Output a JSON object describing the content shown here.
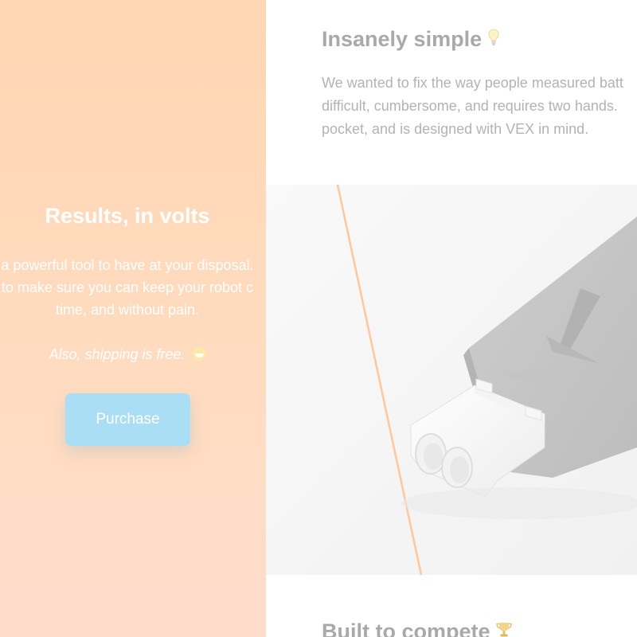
{
  "left": {
    "title": "Results, in volts",
    "body_lines": [
      "a powerful tool to have at your disposal.",
      "to make sure you can keep your robot c",
      "time, and without pain."
    ],
    "note": "Also, shipping is free.",
    "note_emoji": "grinning-face-icon",
    "purchase_label": "Purchase"
  },
  "right": {
    "section1": {
      "title": "Insanely simple",
      "icon": "lightbulb-icon",
      "body_lines": [
        "We wanted to fix the way people measured batt",
        "difficult, cumbersome, and requires two hands.",
        "pocket, and is designed with VEX in mind."
      ]
    },
    "hero": {
      "subject": "product-connector-image"
    },
    "section2": {
      "title": "Built to compete",
      "icon": "trophy-icon"
    }
  },
  "colors": {
    "left_panel_bg": "#ffd6b3",
    "button_bg": "#a9def5",
    "heading_gray": "#a9a9a9",
    "body_gray": "#b3b3b3",
    "accent_line": "#ffc79a",
    "product_gray": "#c8c8c8"
  }
}
